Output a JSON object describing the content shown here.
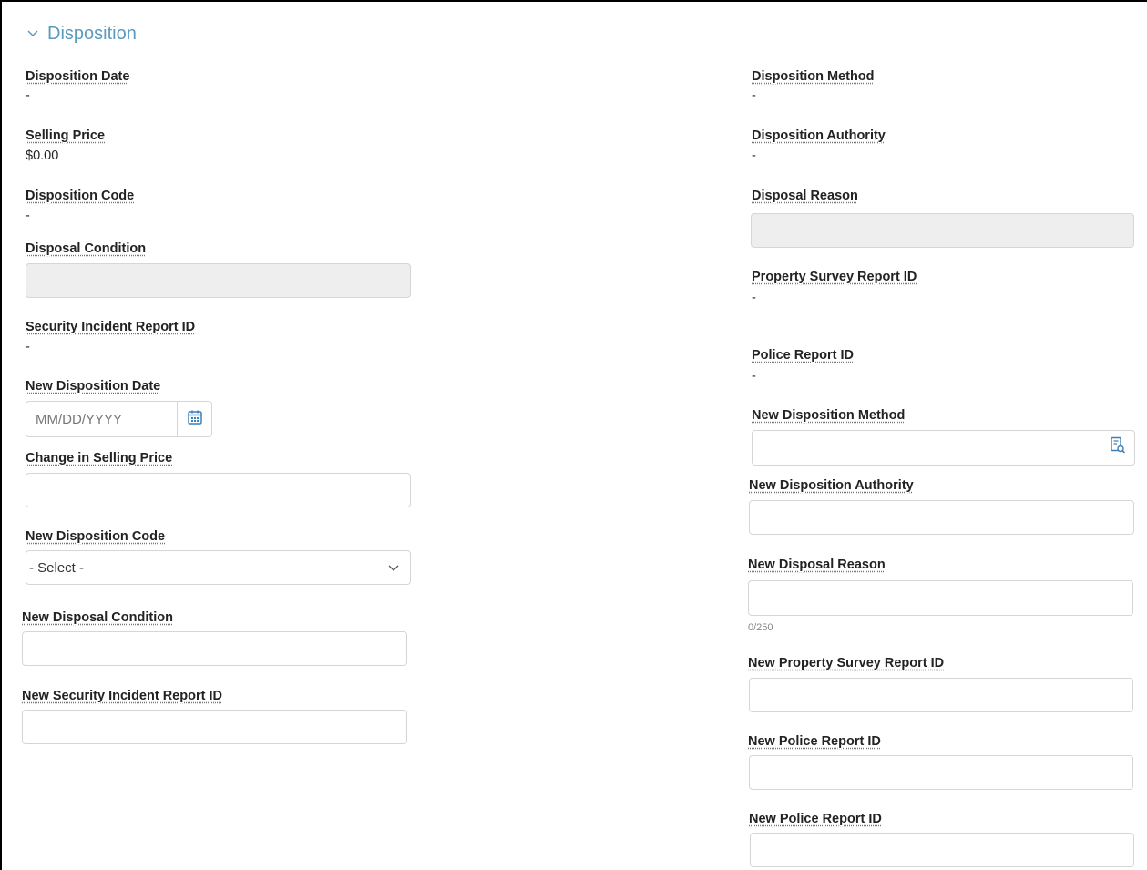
{
  "section": {
    "title": "Disposition"
  },
  "left": {
    "disposition_date": {
      "label": "Disposition Date",
      "value": "-"
    },
    "selling_price": {
      "label": "Selling Price",
      "value": "$0.00"
    },
    "disposition_code": {
      "label": "Disposition Code",
      "value": "-"
    },
    "disposal_condition": {
      "label": "Disposal Condition",
      "value": ""
    },
    "security_incident_report_id": {
      "label": "Security Incident Report ID",
      "value": "-"
    },
    "new_disposition_date": {
      "label": "New Disposition Date",
      "placeholder": "MM/DD/YYYY",
      "value": ""
    },
    "change_in_selling_price": {
      "label": "Change in Selling Price",
      "value": ""
    },
    "new_disposition_code": {
      "label": "New Disposition Code",
      "selected": "- Select -"
    },
    "new_disposal_condition": {
      "label": "New Disposal Condition",
      "value": ""
    },
    "new_security_incident_report_id": {
      "label": "New Security Incident Report ID",
      "value": ""
    }
  },
  "right": {
    "disposition_method": {
      "label": "Disposition Method",
      "value": "-"
    },
    "disposition_authority": {
      "label": "Disposition Authority",
      "value": "-"
    },
    "disposal_reason": {
      "label": "Disposal Reason",
      "value": ""
    },
    "property_survey_report_id": {
      "label": "Property Survey Report ID",
      "value": "-"
    },
    "police_report_id": {
      "label": "Police Report ID",
      "value": "-"
    },
    "new_disposition_method": {
      "label": "New Disposition Method",
      "value": ""
    },
    "new_disposition_authority": {
      "label": "New Disposition Authority",
      "value": ""
    },
    "new_disposal_reason": {
      "label": "New Disposal Reason",
      "value": "",
      "counter": "0/250"
    },
    "new_property_survey_report_id": {
      "label": "New Property Survey Report ID",
      "value": ""
    },
    "new_police_report_id": {
      "label": "New Police Report ID",
      "value": ""
    },
    "new_police_report_id_2": {
      "label": "New Police Report ID",
      "value": ""
    }
  },
  "icons": {
    "chevron": "chevron-down-icon",
    "calendar": "calendar-icon",
    "lookup": "lookup-icon",
    "dropdown": "chevron-down-icon"
  },
  "colors": {
    "accent": "#5a9bbd",
    "disabled_bg": "#eeeeee",
    "border": "#d6d6d6"
  }
}
